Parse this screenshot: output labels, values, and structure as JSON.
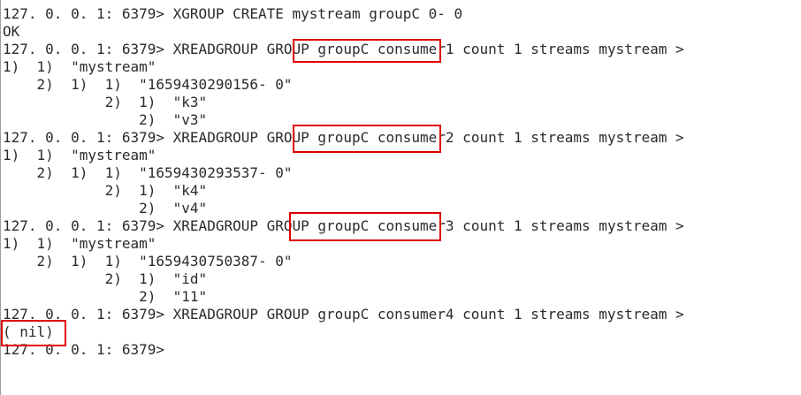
{
  "terminal": {
    "lines": [
      {
        "prefix": "127. 0. 0. 1: 6379> ",
        "text": "XGROUP CREATE mystream groupC ",
        "tail": "0- 0"
      },
      {
        "text": "OK"
      },
      {
        "prefix": "127. 0. 0. 1: 6379> ",
        "text": "XREADGROUP GROUP ",
        "highlight": "groupC consumer1",
        "tail": " count 1 streams mystream >"
      },
      {
        "text": "1)  1)  \"mystream\""
      },
      {
        "text": "    2)  1)  1)  \"1659430290156- 0\""
      },
      {
        "text": "            2)  1)  \"k3\""
      },
      {
        "text": "                2)  \"v3\""
      },
      {
        "prefix": "127. 0. 0. 1: 6379> ",
        "text": "XREADGROUP GROUP ",
        "highlight": "groupC consumer2",
        "tail": " count 1 streams mystream >"
      },
      {
        "text": "1)  1)  \"mystream\""
      },
      {
        "text": "    2)  1)  1)  \"1659430293537- 0\""
      },
      {
        "text": "            2)  1)  \"k4\""
      },
      {
        "text": "                2)  \"v4\""
      },
      {
        "prefix": "127. 0. 0. 1: 6379> ",
        "text": "XREADGROUP GROUP ",
        "highlight": "groupC consumer3",
        "tail": " count 1 streams mystream >"
      },
      {
        "text": "1)  1)  \"mystream\""
      },
      {
        "text": "    2)  1)  1)  \"1659430750387- 0\""
      },
      {
        "text": "            2)  1)  \"id\""
      },
      {
        "text": "                2)  \"11\""
      },
      {
        "prefix": "127. 0. 0. 1: 6379> ",
        "text": "XREADGROUP GROUP groupC consumer4 count 1 streams mystream >"
      },
      {
        "text": "( nil)",
        "boxed": true
      },
      {
        "prefix": "127. 0. 0. 1: 6379> ",
        "text": ""
      }
    ],
    "highlight_color": "#e00000"
  }
}
